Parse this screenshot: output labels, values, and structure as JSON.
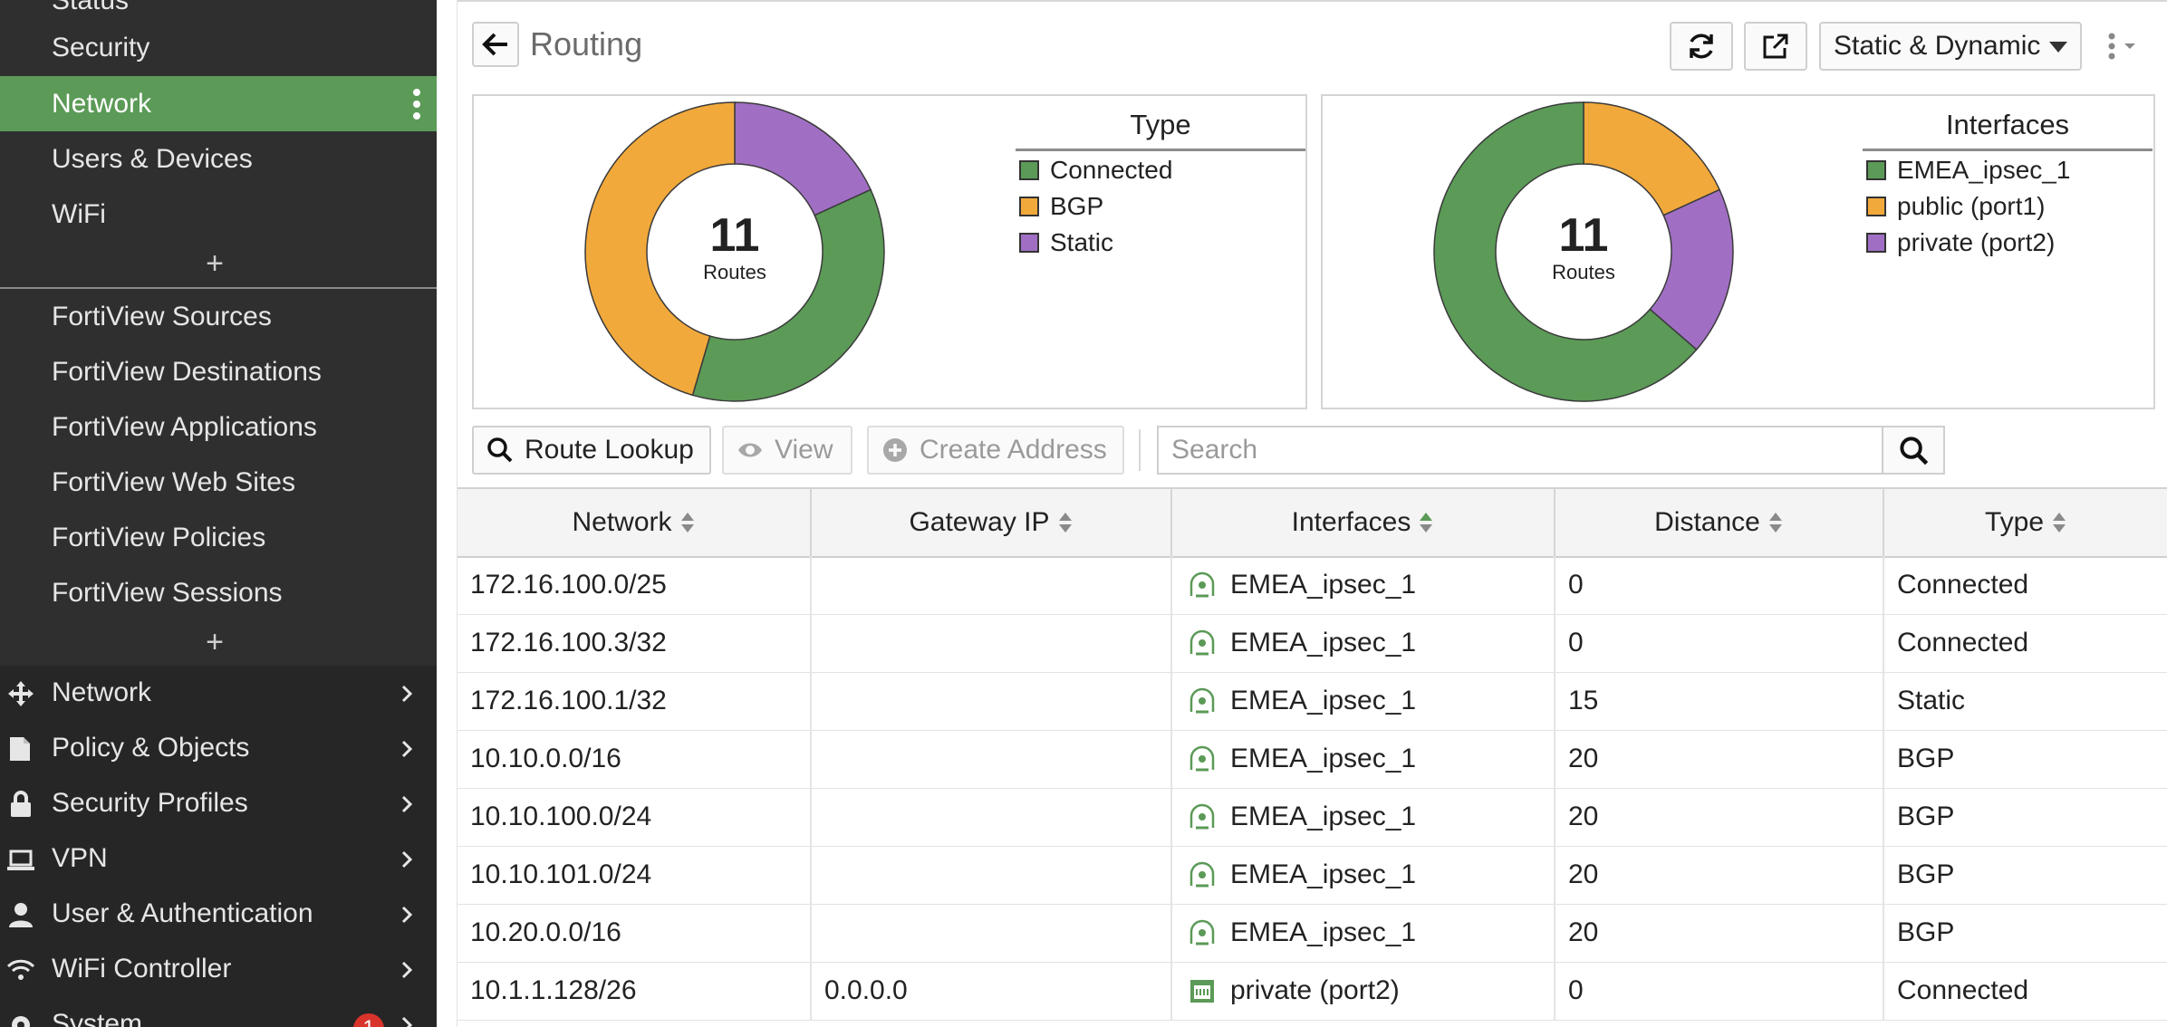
{
  "sidebar": {
    "top_items": [
      {
        "label": "Status"
      },
      {
        "label": "Security"
      },
      {
        "label": "Network",
        "active": true
      },
      {
        "label": "Users & Devices"
      },
      {
        "label": "WiFi"
      }
    ],
    "fortiview_items": [
      {
        "label": "FortiView Sources"
      },
      {
        "label": "FortiView Destinations"
      },
      {
        "label": "FortiView Applications"
      },
      {
        "label": "FortiView Web Sites"
      },
      {
        "label": "FortiView Policies"
      },
      {
        "label": "FortiView Sessions"
      }
    ],
    "nav": [
      {
        "label": "Network",
        "icon": "network-icon"
      },
      {
        "label": "Policy & Objects",
        "icon": "policy-icon"
      },
      {
        "label": "Security Profiles",
        "icon": "lock-icon"
      },
      {
        "label": "VPN",
        "icon": "laptop-icon"
      },
      {
        "label": "User & Authentication",
        "icon": "user-icon"
      },
      {
        "label": "WiFi Controller",
        "icon": "wifi-icon"
      },
      {
        "label": "System",
        "icon": "gear-icon",
        "badge": "1"
      }
    ]
  },
  "header": {
    "title": "Routing",
    "view_selector": "Static & Dynamic"
  },
  "charts": {
    "type_chart": {
      "center_value": "11",
      "center_label": "Routes",
      "legend_title": "Type"
    },
    "interfaces_chart": {
      "center_value": "11",
      "center_label": "Routes",
      "legend_title": "Interfaces"
    }
  },
  "chart_data": [
    {
      "type": "pie",
      "title": "Type",
      "categories": [
        "Connected",
        "BGP",
        "Static"
      ],
      "values": [
        4,
        5,
        2
      ],
      "colors": [
        "#5b9a57",
        "#f2a93b",
        "#a06fc4"
      ]
    },
    {
      "type": "pie",
      "title": "Interfaces",
      "categories": [
        "EMEA_ipsec_1",
        "public (port1)",
        "private (port2)"
      ],
      "values": [
        7,
        2,
        2
      ],
      "colors": [
        "#5b9a57",
        "#f2a93b",
        "#a06fc4"
      ]
    }
  ],
  "toolbar": {
    "route_lookup": "Route Lookup",
    "view": "View",
    "create_address": "Create Address",
    "search_placeholder": "Search"
  },
  "table": {
    "columns": [
      "Network",
      "Gateway IP",
      "Interfaces",
      "Distance",
      "Type"
    ],
    "rows": [
      {
        "network": "172.16.100.0/25",
        "gateway": "",
        "interface": "EMEA_ipsec_1",
        "iface_icon": "tunnel-icon",
        "distance": "0",
        "type": "Connected"
      },
      {
        "network": "172.16.100.3/32",
        "gateway": "",
        "interface": "EMEA_ipsec_1",
        "iface_icon": "tunnel-icon",
        "distance": "0",
        "type": "Connected"
      },
      {
        "network": "172.16.100.1/32",
        "gateway": "",
        "interface": "EMEA_ipsec_1",
        "iface_icon": "tunnel-icon",
        "distance": "15",
        "type": "Static"
      },
      {
        "network": "10.10.0.0/16",
        "gateway": "",
        "interface": "EMEA_ipsec_1",
        "iface_icon": "tunnel-icon",
        "distance": "20",
        "type": "BGP"
      },
      {
        "network": "10.10.100.0/24",
        "gateway": "",
        "interface": "EMEA_ipsec_1",
        "iface_icon": "tunnel-icon",
        "distance": "20",
        "type": "BGP"
      },
      {
        "network": "10.10.101.0/24",
        "gateway": "",
        "interface": "EMEA_ipsec_1",
        "iface_icon": "tunnel-icon",
        "distance": "20",
        "type": "BGP"
      },
      {
        "network": "10.20.0.0/16",
        "gateway": "",
        "interface": "EMEA_ipsec_1",
        "iface_icon": "tunnel-icon",
        "distance": "20",
        "type": "BGP"
      },
      {
        "network": "10.1.1.128/26",
        "gateway": "0.0.0.0",
        "interface": "private (port2)",
        "iface_icon": "port-icon",
        "distance": "0",
        "type": "Connected"
      }
    ]
  }
}
